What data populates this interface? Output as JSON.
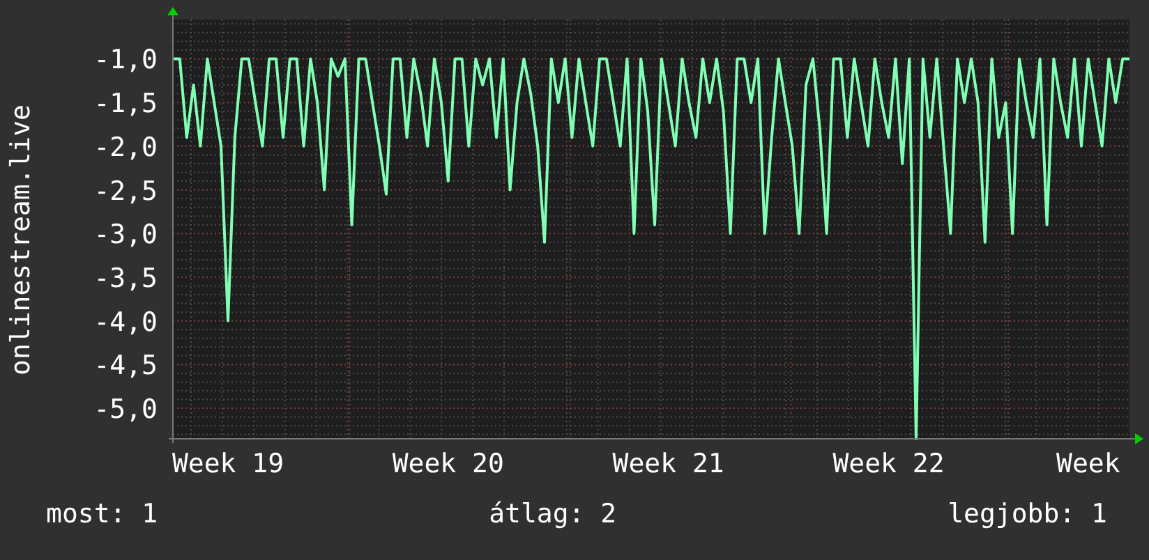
{
  "chart": {
    "chart_data": {
      "type": "line",
      "ylabel": "onlinestream.live",
      "grid": true,
      "ylim": [
        -5.35,
        -0.55
      ],
      "categories": [
        null,
        null,
        null,
        null,
        null,
        null,
        null,
        null,
        "Week 19",
        null,
        null,
        null,
        null,
        null,
        null,
        null,
        null,
        null,
        null,
        null,
        null,
        null,
        null,
        null,
        null,
        null,
        null,
        null,
        null,
        null,
        null,
        null,
        null,
        null,
        null,
        null,
        null,
        null,
        null,
        null,
        "Week 20",
        null,
        null,
        null,
        null,
        null,
        null,
        null,
        null,
        null,
        null,
        null,
        null,
        null,
        null,
        null,
        null,
        null,
        null,
        null,
        null,
        null,
        null,
        null,
        null,
        null,
        null,
        null,
        null,
        null,
        null,
        null,
        "Week 21",
        null,
        null,
        null,
        null,
        null,
        null,
        null,
        null,
        null,
        null,
        null,
        null,
        null,
        null,
        null,
        null,
        null,
        null,
        null,
        null,
        null,
        null,
        null,
        null,
        null,
        null,
        null,
        null,
        null,
        null,
        null,
        "Week 22",
        null,
        null,
        null,
        null,
        null,
        null,
        null,
        null,
        null,
        null,
        null,
        null,
        null,
        null,
        null,
        null,
        null,
        null,
        null,
        null,
        null,
        null,
        null,
        null,
        null,
        null,
        null,
        null,
        "Week",
        null,
        null,
        null,
        null,
        null,
        null
      ],
      "yticks": [
        {
          "value": -1,
          "label": "-1,0"
        },
        {
          "value": -1.5,
          "label": "-1,5"
        },
        {
          "value": -2,
          "label": "-2,0"
        },
        {
          "value": -2.5,
          "label": "-2,5"
        },
        {
          "value": -3,
          "label": "-3,0"
        },
        {
          "value": -3.5,
          "label": "-3,5"
        },
        {
          "value": -4,
          "label": "-4,0"
        },
        {
          "value": -4.5,
          "label": "-4,5"
        },
        {
          "value": -5,
          "label": "-5,0"
        }
      ],
      "series": [
        {
          "color": "#80ffb4",
          "values": [
            -1,
            -1,
            -1.9,
            -1.3,
            -2,
            -1,
            -1.5,
            -2,
            -4,
            -1.9,
            -1,
            -1,
            -1.5,
            -2,
            -1,
            -1,
            -1.9,
            -1,
            -1,
            -2,
            -1,
            -1.5,
            -2.5,
            -1,
            -1.2,
            -1,
            -2.9,
            -1,
            -1,
            -1.5,
            -2,
            -2.55,
            -1,
            -1,
            -1.9,
            -1,
            -1.4,
            -2,
            -1,
            -1.5,
            -2.4,
            -1,
            -1,
            -2,
            -1,
            -1.3,
            -1,
            -1.9,
            -1,
            -2.5,
            -1.5,
            -1,
            -1.4,
            -2,
            -3.1,
            -1,
            -1.5,
            -1,
            -1.9,
            -1,
            -1.5,
            -2,
            -1,
            -1,
            -1.5,
            -2,
            -1,
            -3,
            -1,
            -1.6,
            -2.9,
            -1,
            -1.5,
            -2,
            -1,
            -1.5,
            -1.9,
            -1,
            -1.5,
            -1,
            -1.6,
            -3,
            -1,
            -1,
            -1.5,
            -1,
            -3,
            -1.9,
            -1,
            -1.5,
            -2,
            -3,
            -1.3,
            -1,
            -1.8,
            -3,
            -1,
            -1,
            -1.9,
            -1,
            -1.5,
            -2,
            -1,
            -1.5,
            -1.9,
            -1,
            -2.2,
            -1,
            -5.35,
            -1,
            -1.9,
            -1,
            -2,
            -3,
            -1,
            -1.5,
            -1,
            -1.5,
            -3.1,
            -1,
            -1.9,
            -1.5,
            -3,
            -1,
            -1.5,
            -1.9,
            -1,
            -2.9,
            -1,
            -1.5,
            -1.9,
            -1,
            -2,
            -1,
            -1.5,
            -2,
            -1,
            -1.5,
            -1,
            -1
          ]
        }
      ]
    }
  },
  "legend": [
    {
      "text": "most: 1"
    },
    {
      "text": "átlag: 2"
    },
    {
      "text": "legjobb: 1"
    }
  ]
}
